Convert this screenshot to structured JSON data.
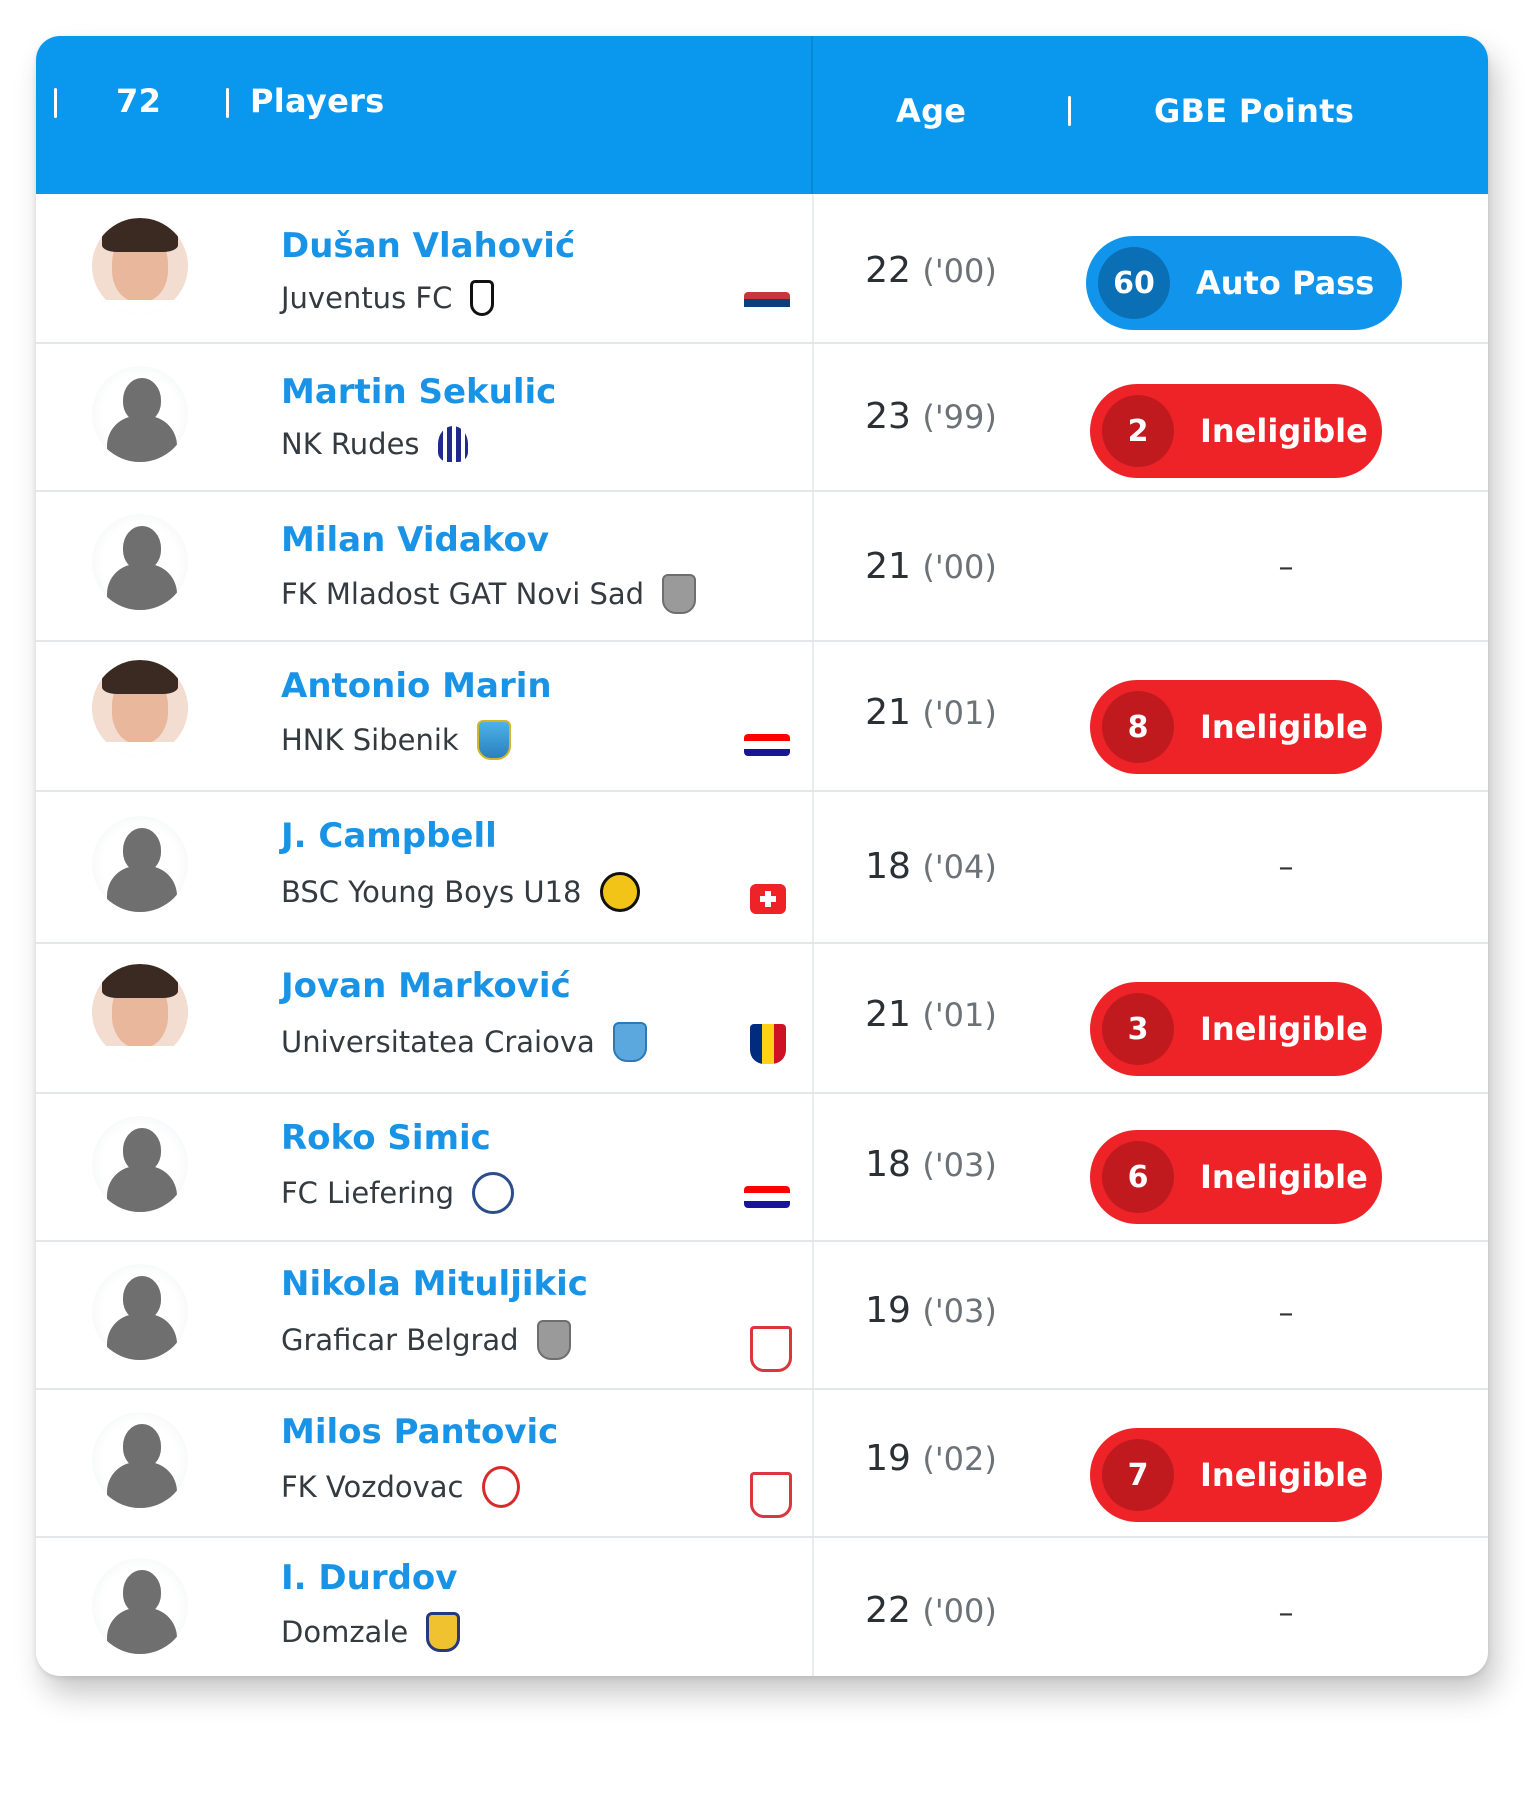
{
  "header": {
    "count": "72",
    "players_label": "Players",
    "age_label": "Age",
    "points_label": "GBE Points"
  },
  "players": [
    {
      "name": "Dušan Vlahović",
      "club": "Juventus FC",
      "age": "22",
      "year": "('00)",
      "points": "60",
      "status": "Auto Pass"
    },
    {
      "name": "Martin Sekulic",
      "club": "NK Rudes",
      "age": "23",
      "year": "('99)",
      "points": "2",
      "status": "Ineligible"
    },
    {
      "name": "Milan Vidakov",
      "club": "FK Mladost GAT Novi Sad",
      "age": "21",
      "year": "('00)",
      "points": "",
      "status": "–"
    },
    {
      "name": "Antonio Marin",
      "club": "HNK Sibenik",
      "age": "21",
      "year": "('01)",
      "points": "8",
      "status": "Ineligible"
    },
    {
      "name": "J. Campbell",
      "club": "BSC Young Boys U18",
      "age": "18",
      "year": "('04)",
      "points": "",
      "status": "–"
    },
    {
      "name": "Jovan Marković",
      "club": "Universitatea Craiova",
      "age": "21",
      "year": "('01)",
      "points": "3",
      "status": "Ineligible"
    },
    {
      "name": "Roko Simic",
      "club": "FC Liefering",
      "age": "18",
      "year": "('03)",
      "points": "6",
      "status": "Ineligible"
    },
    {
      "name": "Nikola Mituljikic",
      "club": "Graficar Belgrad",
      "age": "19",
      "year": "('03)",
      "points": "",
      "status": "–"
    },
    {
      "name": "Milos Pantovic",
      "club": "FK Vozdovac",
      "age": "19",
      "year": "('02)",
      "points": "7",
      "status": "Ineligible"
    },
    {
      "name": "I. Durdov",
      "club": "Domzale",
      "age": "22",
      "year": "('00)",
      "points": "",
      "status": "–"
    }
  ],
  "colors": {
    "header_blue": "#0a98ef",
    "name_blue": "#1993e6",
    "auto_pass": "#1195ec",
    "ineligible": "#ee2328"
  }
}
